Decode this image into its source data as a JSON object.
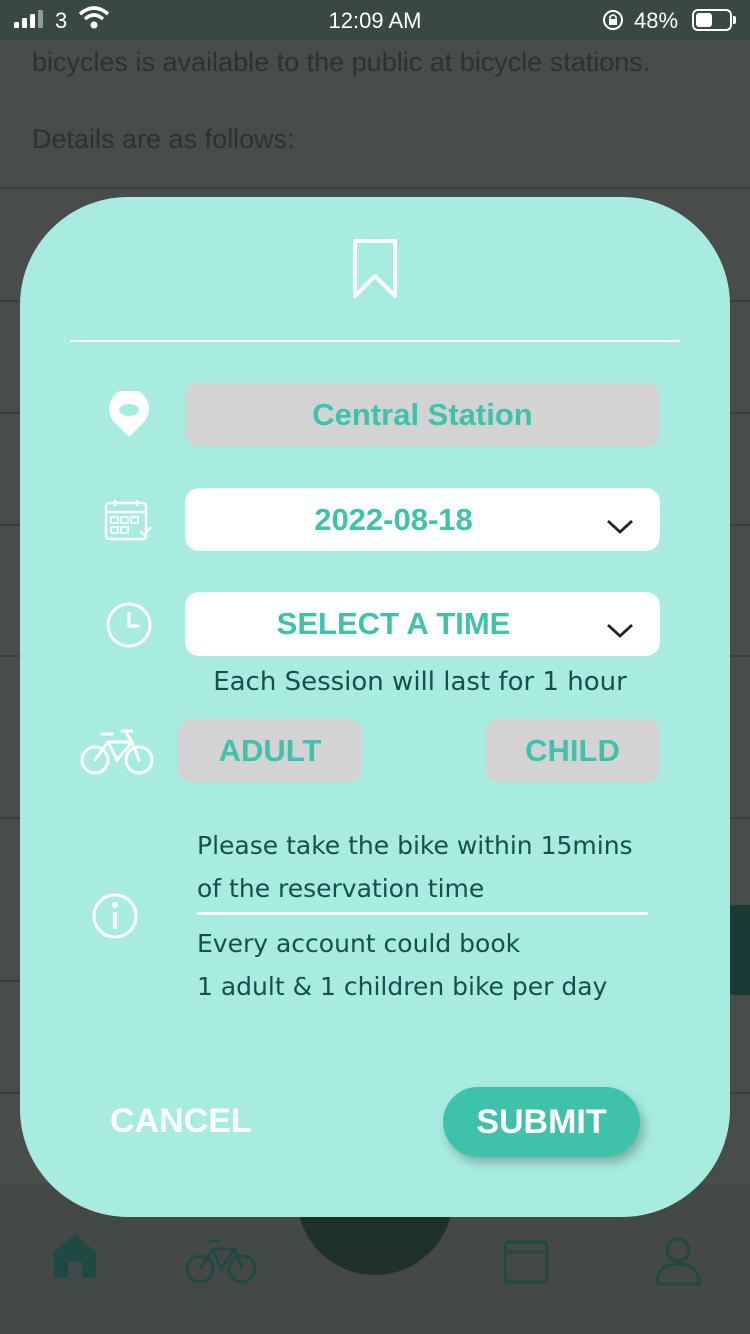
{
  "status_bar": {
    "carrier": "3",
    "time": "12:09 AM",
    "battery": "48%"
  },
  "background": {
    "text_line_1": "bicycles is available to the public at bicycle stations.",
    "text_line_2": "Details are as follows:",
    "tabs": [
      "home-icon",
      "bicycle-icon",
      "scan-icon",
      "calendar-icon",
      "profile-icon"
    ]
  },
  "modal": {
    "header_icon": "bookmark-icon",
    "station": {
      "icon": "location-pin-icon",
      "value": "Central Station"
    },
    "date": {
      "icon": "calendar-icon",
      "value": "2022-08-18"
    },
    "time": {
      "icon": "clock-icon",
      "value": "SELECT A TIME"
    },
    "session_note": "Each Session will last for 1 hour",
    "bike_type": {
      "icon": "bicycle-icon",
      "adult_label": "ADULT",
      "child_label": "CHILD"
    },
    "info": {
      "icon": "info-icon",
      "line_1": "Please take the bike within 15mins",
      "line_2": "of the reservation time",
      "line_3": "Every account could book",
      "line_4": "1 adult & 1 children bike per day"
    },
    "cancel_label": "CANCEL",
    "submit_label": "SUBMIT"
  },
  "colors": {
    "modal_bg": "#a8ebe0",
    "accent": "#3ec2ac",
    "dark_text": "#15504a",
    "pill_grey": "#d3d3d3"
  }
}
